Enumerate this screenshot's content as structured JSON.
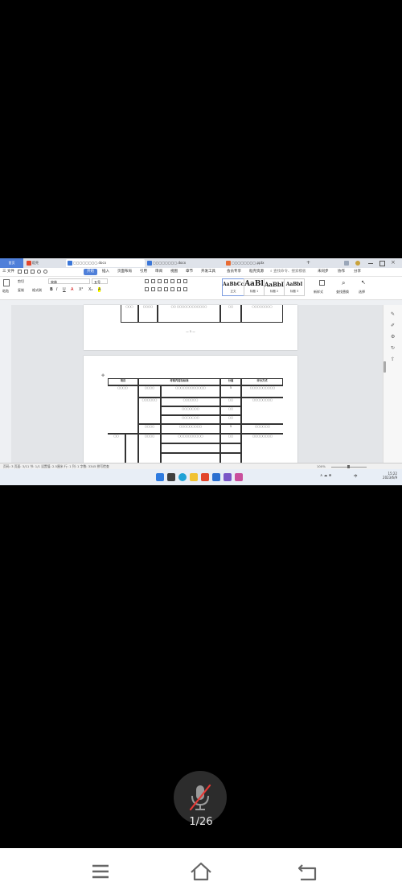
{
  "browser": {
    "home_tab": "首页",
    "tabs": [
      {
        "label": "稻壳",
        "color": "#e2452b"
      },
      {
        "label": "▢▢▢▢▢▢▢▢.docx",
        "color": "#3a76d8",
        "active": true
      },
      {
        "label": "▢▢▢▢▢▢▢▢.docx",
        "color": "#3a76d8"
      },
      {
        "label": "▢▢▢▢▢▢▢▢.pptx",
        "color": "#e86b33"
      }
    ],
    "new_tab": "+"
  },
  "menubar": {
    "file": "三 文件",
    "items": [
      "开始",
      "插入",
      "页面布局",
      "引用",
      "审阅",
      "视图",
      "章节",
      "开发工具",
      "会员专享",
      "稻壳资源"
    ],
    "active_index": 0,
    "search_placeholder": "查找命令、搜索模板",
    "right": [
      "未同步",
      "协作",
      "分享"
    ]
  },
  "toolbar": {
    "paste": "粘贴",
    "cut": "剪切",
    "copy": "复制",
    "format_painter": "格式刷",
    "font": "宋体",
    "font_size": "五号",
    "styles": [
      {
        "sample": "AaBbCcI",
        "caption": "正文"
      },
      {
        "sample": "AaBl",
        "caption": "标题 1"
      },
      {
        "sample": "AaBbI",
        "caption": "标题 2"
      },
      {
        "sample": "AaBbI",
        "caption": "标题 3"
      }
    ],
    "new_style": "新样式",
    "find_replace": "查找替换",
    "select": "选择"
  },
  "document": {
    "top_table_rows": [
      {
        "c1": "▢▢▢",
        "c2": "▢▢▢▢",
        "c3": "▢▢ ▢▢▢▢▢▢▢▢▢▢▢▢",
        "c4": "▢▢",
        "c5": "▢▢▢▢▢▢▢▢"
      }
    ],
    "page_number": "— 1 —",
    "table_header": [
      "项目",
      "考核内容及标准",
      "分值",
      "评分方式"
    ],
    "table_rows": [
      {
        "cat": "",
        "sub": "▢▢▢▢",
        "content": "▢▢▢▢▢▢▢▢▢▢▢▢",
        "score": "5",
        "method": "▢▢▢▢▢▢▢▢▢▢"
      },
      {
        "cat": "▢▢▢▢",
        "sub": "▢▢▢▢▢▢",
        "content": "▢▢▢▢▢▢",
        "score": "▢▢",
        "method": "▢▢▢▢▢▢▢▢"
      },
      {
        "cat": "",
        "sub": "",
        "content": "▢▢▢▢▢▢▢",
        "score": "▢▢",
        "method": ""
      },
      {
        "cat": "",
        "sub": "",
        "content": "▢▢▢▢▢▢▢",
        "score": "▢▢",
        "method": ""
      },
      {
        "cat": "",
        "sub": "▢▢▢▢",
        "content": "▢▢▢▢▢▢▢▢▢",
        "score": "5",
        "method": "▢▢▢▢▢▢"
      },
      {
        "cat": "▢▢",
        "sub": "▢▢▢▢",
        "content": "▢▢▢▢▢▢▢▢▢▢",
        "score": "▢▢",
        "method": "▢▢▢▢▢▢▢▢"
      }
    ]
  },
  "statusbar": {
    "left": "页码: 3  页面: 3/11  节: 1/1  设置值: 2.5厘米  行: 1  列: 1  字数: 3345  拼写检查",
    "zoom": "100%"
  },
  "taskbar": {
    "tray_text": "中",
    "time": "15:22",
    "date": "2023/6/9"
  },
  "viewer": {
    "mic_state": "muted",
    "page_counter": "1/26"
  },
  "android_nav": {
    "icons": [
      "menu-icon",
      "home-icon",
      "back-icon"
    ]
  }
}
